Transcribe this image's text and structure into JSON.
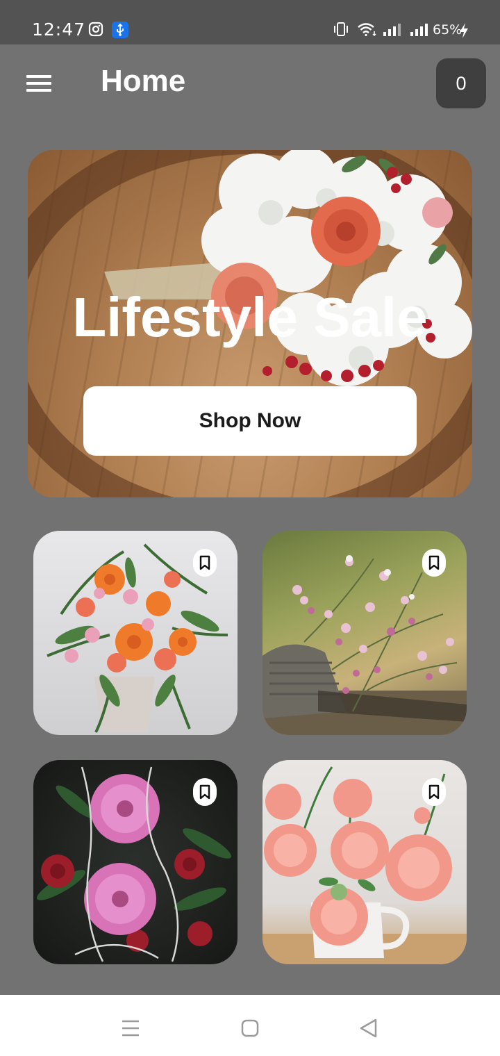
{
  "status_bar": {
    "time": "12:47",
    "battery": "65%",
    "icons": [
      "instagram-icon",
      "usb-icon",
      "vibrate-icon",
      "wifi-icon",
      "signal-icon",
      "signal-icon",
      "charging-icon"
    ]
  },
  "app_bar": {
    "title": "Home",
    "cart_count": "0",
    "menu_icon": "hamburger-menu-icon"
  },
  "hero": {
    "title": "Lifestyle Sale",
    "button_label": "Shop Now"
  },
  "products": [
    {
      "name": "orange-gerbera-bouquet",
      "bookmark_icon": "bookmark-icon"
    },
    {
      "name": "pink-wildflower-basket",
      "bookmark_icon": "bookmark-icon"
    },
    {
      "name": "pink-gerbera-roses-bouquet",
      "bookmark_icon": "bookmark-icon"
    },
    {
      "name": "peach-dahlia-vase",
      "bookmark_icon": "bookmark-icon"
    }
  ],
  "nav_bar": {
    "icons": [
      "recents-icon",
      "home-icon",
      "back-icon"
    ]
  },
  "colors": {
    "background": "#727272",
    "status_bar": "#535353",
    "cart_button": "#3f3f3f",
    "text": "#ffffff"
  }
}
